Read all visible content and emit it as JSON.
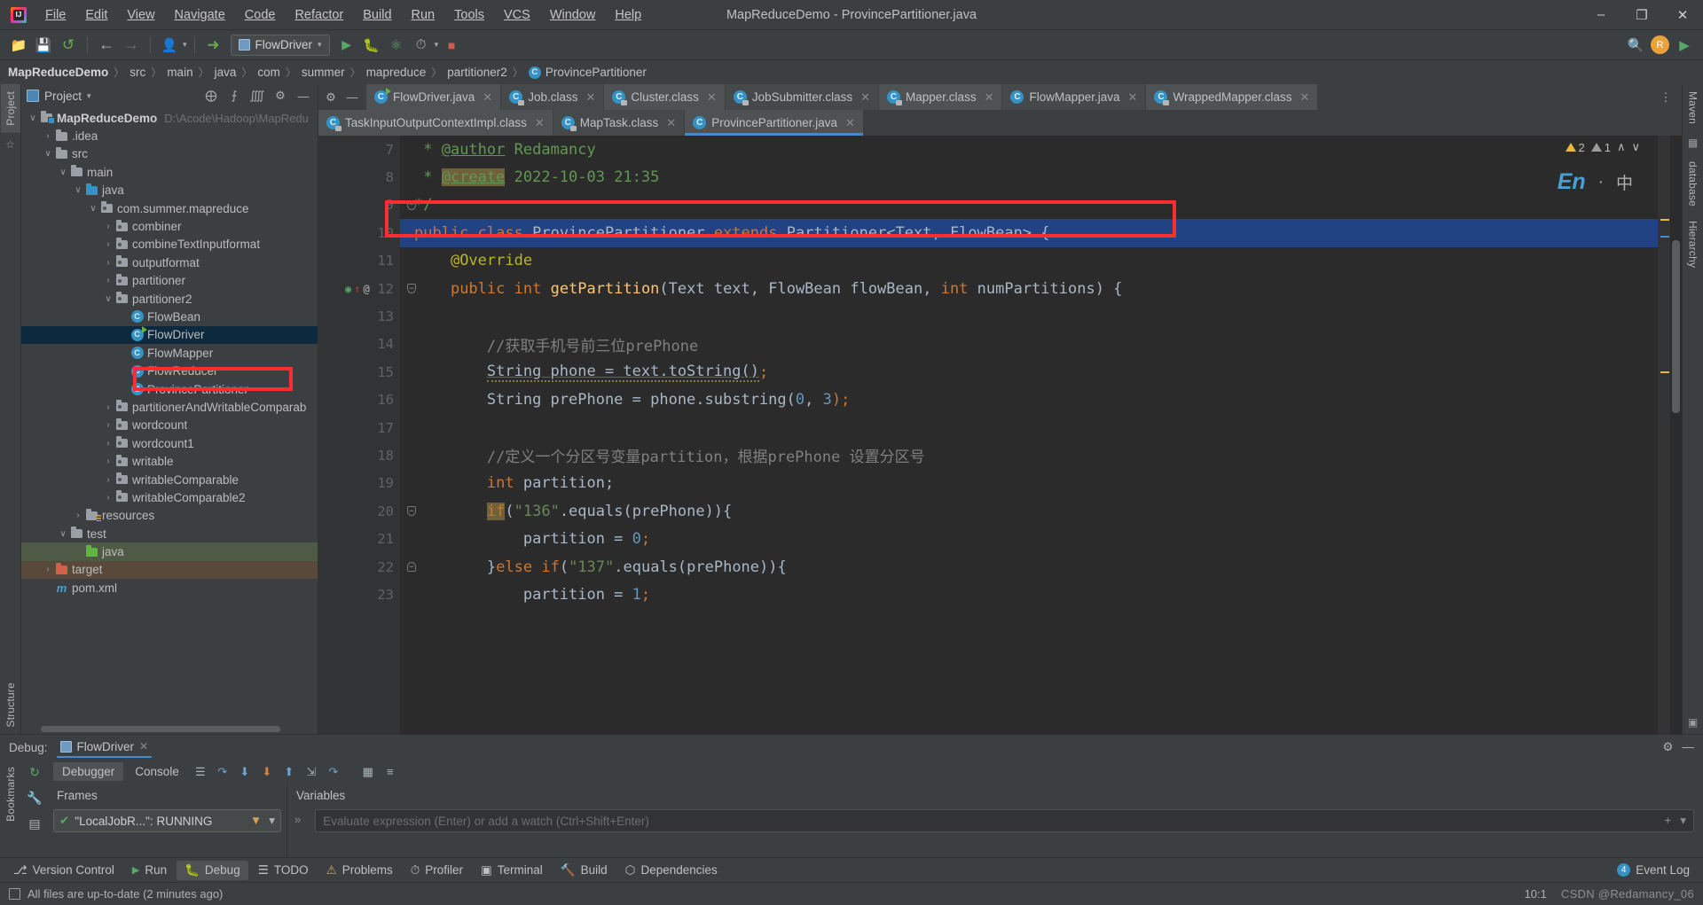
{
  "window": {
    "title": "MapReduceDemo - ProvincePartitioner.java",
    "minimize": "–",
    "maximize": "❐",
    "close": "✕"
  },
  "menubar": [
    {
      "label": "File"
    },
    {
      "label": "Edit"
    },
    {
      "label": "View"
    },
    {
      "label": "Navigate"
    },
    {
      "label": "Code"
    },
    {
      "label": "Refactor"
    },
    {
      "label": "Build"
    },
    {
      "label": "Run"
    },
    {
      "label": "Tools"
    },
    {
      "label": "VCS"
    },
    {
      "label": "Window"
    },
    {
      "label": "Help"
    }
  ],
  "toolbar": {
    "open_icon": "📁",
    "save_icon": "💾",
    "sync_icon": "↺",
    "back_icon": "←",
    "forward_icon": "→",
    "profile_icon": "👤",
    "build_icon": "🔨",
    "run_config_label": "FlowDriver",
    "run_icon": "▶",
    "debug_icon": "🐛",
    "coverage_icon": "▶",
    "profiler_icon": "⏱",
    "stop_icon": "■",
    "search_icon": "🔍",
    "avatar_initial": "R",
    "ide_icon": "▶"
  },
  "breadcrumb": {
    "items": [
      "MapReduceDemo",
      "src",
      "main",
      "java",
      "com",
      "summer",
      "mapreduce",
      "partitioner2"
    ],
    "class_name": "ProvincePartitioner",
    "separator": "〉"
  },
  "project_panel": {
    "title": "Project",
    "dropdown_caret": "▾",
    "locate_icon": "⨁",
    "expand_icon": "⨍",
    "collapse_icon": "⨌",
    "settings_icon": "⚙",
    "hide_icon": "—",
    "tree": [
      {
        "label": "MapReduceDemo",
        "path": "D:\\Acode\\Hadoop\\MapRedu",
        "indent": 0,
        "arrow": "∨",
        "icon": "module-folder",
        "bold": true,
        "state": "none"
      },
      {
        "label": ".idea",
        "indent": 1,
        "arrow": "›",
        "icon": "folder",
        "state": "none"
      },
      {
        "label": "src",
        "indent": 1,
        "arrow": "∨",
        "icon": "folder",
        "state": "none"
      },
      {
        "label": "main",
        "indent": 2,
        "arrow": "∨",
        "icon": "folder",
        "state": "none"
      },
      {
        "label": "java",
        "indent": 3,
        "arrow": "∨",
        "icon": "folder-blue",
        "state": "none"
      },
      {
        "label": "com.summer.mapreduce",
        "indent": 4,
        "arrow": "∨",
        "icon": "package",
        "state": "none"
      },
      {
        "label": "combiner",
        "indent": 5,
        "arrow": "›",
        "icon": "package",
        "state": "none"
      },
      {
        "label": "combineTextInputformat",
        "indent": 5,
        "arrow": "›",
        "icon": "package",
        "state": "none"
      },
      {
        "label": "outputformat",
        "indent": 5,
        "arrow": "›",
        "icon": "package",
        "state": "none"
      },
      {
        "label": "partitioner",
        "indent": 5,
        "arrow": "›",
        "icon": "package",
        "state": "none"
      },
      {
        "label": "partitioner2",
        "indent": 5,
        "arrow": "∨",
        "icon": "package",
        "state": "none"
      },
      {
        "label": "FlowBean",
        "indent": 6,
        "arrow": "",
        "icon": "class",
        "state": "none"
      },
      {
        "label": "FlowDriver",
        "indent": 6,
        "arrow": "",
        "icon": "class-runnable",
        "state": "selected-blue"
      },
      {
        "label": "FlowMapper",
        "indent": 6,
        "arrow": "",
        "icon": "class",
        "state": "none"
      },
      {
        "label": "FlowReducer",
        "indent": 6,
        "arrow": "",
        "icon": "class",
        "state": "none"
      },
      {
        "label": "ProvincePartitioner",
        "indent": 6,
        "arrow": "",
        "icon": "class",
        "state": "highlight-red"
      },
      {
        "label": "partitionerAndWritableComparab",
        "indent": 5,
        "arrow": "›",
        "icon": "package",
        "state": "none"
      },
      {
        "label": "wordcount",
        "indent": 5,
        "arrow": "›",
        "icon": "package",
        "state": "none"
      },
      {
        "label": "wordcount1",
        "indent": 5,
        "arrow": "›",
        "icon": "package",
        "state": "none"
      },
      {
        "label": "writable",
        "indent": 5,
        "arrow": "›",
        "icon": "package",
        "state": "none"
      },
      {
        "label": "writableComparable",
        "indent": 5,
        "arrow": "›",
        "icon": "package",
        "state": "none"
      },
      {
        "label": "writableComparable2",
        "indent": 5,
        "arrow": "›",
        "icon": "package",
        "state": "none"
      },
      {
        "label": "resources",
        "indent": 3,
        "arrow": "›",
        "icon": "folder-res",
        "state": "none"
      },
      {
        "label": "test",
        "indent": 2,
        "arrow": "∨",
        "icon": "folder",
        "state": "none"
      },
      {
        "label": "java",
        "indent": 3,
        "arrow": "",
        "icon": "folder-green",
        "state": "selected-green"
      },
      {
        "label": "target",
        "indent": 1,
        "arrow": "›",
        "icon": "folder-orange",
        "state": "selected-brown"
      },
      {
        "label": "pom.xml",
        "indent": 1,
        "arrow": "",
        "icon": "maven",
        "state": "none"
      }
    ]
  },
  "editor_tabs": {
    "settings_icon": "⚙",
    "hide_icon": "—",
    "row1": [
      {
        "label": "FlowDriver.java",
        "icon": "class-runnable",
        "close": "✕",
        "active": false
      },
      {
        "label": "Job.class",
        "icon": "class-locked",
        "close": "✕",
        "active": false
      },
      {
        "label": "Cluster.class",
        "icon": "class-locked",
        "close": "✕",
        "active": false
      },
      {
        "label": "JobSubmitter.class",
        "icon": "class-locked",
        "close": "✕",
        "active": false
      },
      {
        "label": "Mapper.class",
        "icon": "class-locked",
        "close": "✕",
        "active": false
      },
      {
        "label": "FlowMapper.java",
        "icon": "class",
        "close": "✕",
        "active": false
      },
      {
        "label": "WrappedMapper.class",
        "icon": "class-locked",
        "close": "✕",
        "active": false
      }
    ],
    "row2": [
      {
        "label": "TaskInputOutputContextImpl.class",
        "icon": "class-locked",
        "close": "✕",
        "active": false
      },
      {
        "label": "MapTask.class",
        "icon": "class-locked",
        "close": "✕",
        "active": false
      },
      {
        "label": "ProvincePartitioner.java",
        "icon": "class",
        "close": "✕",
        "active": true
      }
    ],
    "more_icon": "⋮"
  },
  "inspections": {
    "warning_count": "2",
    "weak_warning_count": "1",
    "up_icon": "∧",
    "down_icon": "∨"
  },
  "floating": {
    "en_label": "En",
    "cn_char": "中",
    "dot": "·"
  },
  "code": {
    "lines": [
      {
        "num": "7",
        "fold": "",
        "marks": ""
      },
      {
        "num": "8",
        "fold": "",
        "marks": ""
      },
      {
        "num": "9",
        "fold": "minus",
        "marks": ""
      },
      {
        "num": "10",
        "fold": "",
        "marks": "",
        "highlight": true
      },
      {
        "num": "11",
        "fold": "",
        "marks": ""
      },
      {
        "num": "12",
        "fold": "minus",
        "marks": "override"
      },
      {
        "num": "13",
        "fold": "",
        "marks": ""
      },
      {
        "num": "14",
        "fold": "",
        "marks": ""
      },
      {
        "num": "15",
        "fold": "",
        "marks": ""
      },
      {
        "num": "16",
        "fold": "",
        "marks": ""
      },
      {
        "num": "17",
        "fold": "",
        "marks": ""
      },
      {
        "num": "18",
        "fold": "",
        "marks": ""
      },
      {
        "num": "19",
        "fold": "",
        "marks": ""
      },
      {
        "num": "20",
        "fold": "minus",
        "marks": ""
      },
      {
        "num": "21",
        "fold": "",
        "marks": ""
      },
      {
        "num": "22",
        "fold": "plus",
        "marks": ""
      },
      {
        "num": "23",
        "fold": "",
        "marks": ""
      }
    ],
    "text": {
      "l7": " * @author Redamancy",
      "l8": " * @create 2022-10-03 21:35",
      "l9": " */",
      "l10": "public class ProvincePartitioner extends Partitioner<Text, FlowBean> {",
      "l11": "    @Override",
      "l12": "    public int getPartition(Text text, FlowBean flowBean, int numPartitions) {",
      "l13": "",
      "l14": "        //获取手机号前三位prePhone",
      "l15": "        String phone = text.toString();",
      "l16": "        String prePhone = phone.substring(0, 3);",
      "l17": "",
      "l18": "        //定义一个分区号变量partition，根据prePhone 设置分区号",
      "l19": "        int partition;",
      "l20": "        if(\"136\".equals(prePhone)){",
      "l21": "            partition = 0;",
      "l22": "        }else if(\"137\".equals(prePhone)){",
      "l23": "            partition = 1;"
    },
    "tokens": {
      "author_tag": "@author",
      "author_name": "Redamancy",
      "create_tag": "@create",
      "create_date": "2022-10-03 21:35",
      "comment_end": "*/",
      "kw_public": "public",
      "kw_class": "class",
      "cls_name": "ProvincePartitioner",
      "kw_extends": "extends",
      "generic_sig": "Partitioner<Text, FlowBean> {",
      "annotation_override": "@Override",
      "kw_int": "int",
      "method_name": "getPartition",
      "method_params": "(Text text, FlowBean flowBean, ",
      "method_params_tail": " numPartitions) {",
      "cmt14": "//获取手机号前三位prePhone",
      "l15_a": "String phone = text.toString()",
      "l15_semi": ";",
      "l16_a": "String prePhone = phone.substring(",
      "l16_zero": "0",
      "l16_comma": ", ",
      "l16_three": "3",
      "l16_end": ");",
      "cmt18": "//定义一个分区号变量partition，根据prePhone 设置分区号",
      "l19_var": " partition;",
      "kw_if": "if",
      "l20_str": "\"136\"",
      "l20_rest": ".equals(prePhone)){",
      "l21_a": "partition = ",
      "l21_zero": "0",
      "l21_semi": ";",
      "l22_brace": "}",
      "kw_else": "else",
      "l22_str": "\"137\"",
      "l22_rest": ".equals(prePhone)){",
      "l23_one": "1"
    }
  },
  "debug_panel": {
    "label": "Debug:",
    "config_name": "FlowDriver",
    "close_icon": "✕",
    "settings_icon": "⚙",
    "hide_icon": "—",
    "tabs": [
      {
        "label": "Debugger",
        "selected": true
      },
      {
        "label": "Console",
        "selected": false
      }
    ],
    "toolbar_icons": [
      "☰",
      "⤴",
      "⤵",
      "⬇",
      "⬆",
      "⤵",
      "⤴",
      "▦",
      "≡"
    ],
    "left_tools": [
      "↻",
      "🔧",
      "☰"
    ],
    "frames_header": "Frames",
    "frame_thread": "\"LocalJobR...\": RUNNING",
    "frame_filter_icon": "▼",
    "frame_caret": "▾",
    "variables_header": "Variables",
    "watch_placeholder": "Evaluate expression (Enter) or add a watch (Ctrl+Shift+Enter)",
    "watch_plus": "+",
    "watch_caret": "▾",
    "expand_icon": "»"
  },
  "bottom_toolbar": {
    "items": [
      {
        "label": "Version Control",
        "icon": "⎇"
      },
      {
        "label": "Run",
        "icon": "▶"
      },
      {
        "label": "Debug",
        "icon": "🐛",
        "selected": true
      },
      {
        "label": "TODO",
        "icon": "☰"
      },
      {
        "label": "Problems",
        "icon": "⚠"
      },
      {
        "label": "Profiler",
        "icon": "⏱"
      },
      {
        "label": "Terminal",
        "icon": "▣"
      },
      {
        "label": "Build",
        "icon": "🔨"
      },
      {
        "label": "Dependencies",
        "icon": "⬡"
      }
    ],
    "event_log_label": "Event Log",
    "event_badge": "4"
  },
  "statusbar": {
    "message": "All files are up-to-date (2 minutes ago)",
    "caret_position": "10:1",
    "watermark": "CSDN @Redamancy_06"
  },
  "left_rail": {
    "project_tab": "Project",
    "structure_tab": "Structure",
    "bookmarks_tab": "Bookmarks",
    "favorites_icon": "☆"
  },
  "right_rail": {
    "maven_tab": "Maven",
    "database_tab": "database",
    "hierarchy_tab": "Hierarchy",
    "notifications_icon": "▣"
  },
  "colors": {
    "accent_blue": "#4a88c7",
    "selection_blue": "#214283",
    "annotation_red": "#ff2d2d",
    "keyword_orange": "#cc7832",
    "string_green": "#6a8759",
    "comment_gray": "#808080",
    "javadoc_green": "#629755",
    "number_blue": "#6897bb",
    "method_yellow": "#ffc66d"
  }
}
